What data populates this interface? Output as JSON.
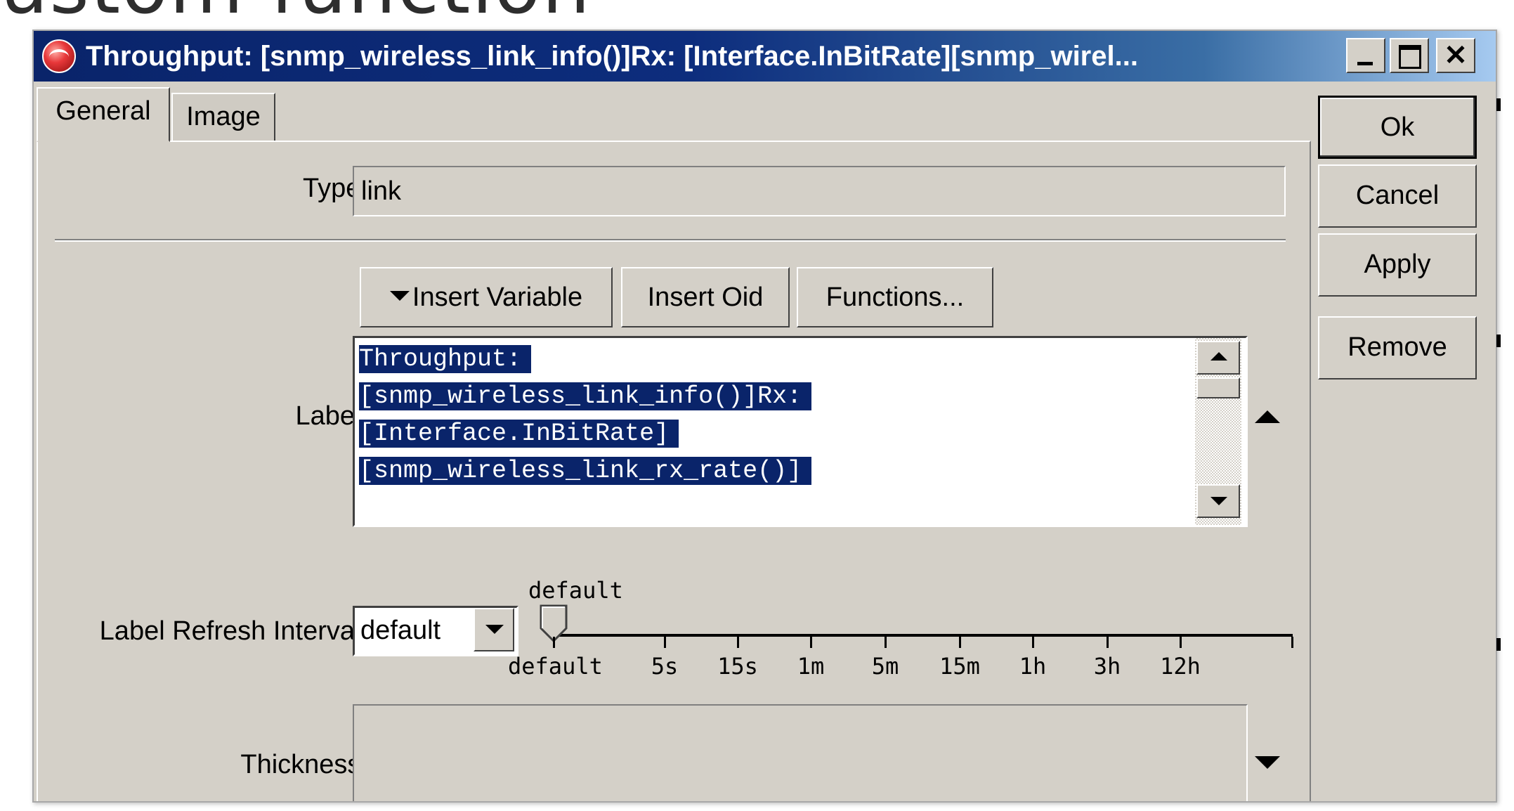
{
  "window": {
    "title": "Throughput: [snmp_wireless_link_info()]Rx: [Interface.InBitRate][snmp_wirel...",
    "close_glyph": "✕"
  },
  "tabs": [
    {
      "label": "General",
      "active": true
    },
    {
      "label": "Image",
      "active": false
    }
  ],
  "form": {
    "type_label": "Type:",
    "type_value": "link",
    "insert_variable_label": "Insert Variable",
    "insert_oid_label": "Insert Oid",
    "functions_label": "Functions...",
    "label_label": "Label:",
    "label_lines": [
      "Throughput:",
      "[snmp_wireless_link_info()]Rx:",
      "[Interface.InBitRate]",
      "[snmp_wireless_link_rx_rate()]"
    ],
    "refresh_label": "Label Refresh Interval:",
    "refresh_value": "default",
    "slider_value": "default",
    "slider_ticks": [
      "default",
      "5s",
      "15s",
      "1m",
      "5m",
      "15m",
      "1h",
      "3h",
      "12h"
    ],
    "thickness_label": "Thickness:"
  },
  "buttons": {
    "ok": "Ok",
    "cancel": "Cancel",
    "apply": "Apply",
    "remove": "Remove"
  },
  "colors": {
    "title_bar": "#0a246a",
    "selection": "#0a246a",
    "face": "#d4d0c8"
  }
}
